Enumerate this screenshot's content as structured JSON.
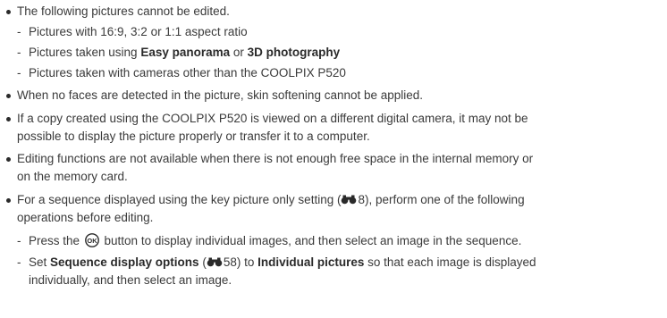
{
  "items": [
    {
      "text": "The following pictures cannot be edited.",
      "subitems": [
        {
          "text": "Pictures with 16:9, 3:2 or 1:1 aspect ratio"
        },
        {
          "pre": "Pictures taken using ",
          "bold1": "Easy panorama",
          "mid": " or ",
          "bold2": "3D photography"
        },
        {
          "text": "Pictures taken with cameras other than the COOLPIX P520"
        }
      ]
    },
    {
      "text": "When no faces are detected in the picture, skin softening cannot be applied."
    },
    {
      "line1": "If a copy created using the COOLPIX P520 is viewed on a different digital camera, it may not be",
      "line2": "possible to display the picture properly or transfer it to a computer."
    },
    {
      "line1": "Editing functions are not available when there is not enough free space in the internal memory or",
      "line2": "on the memory card."
    },
    {
      "pre": "For a sequence displayed using the key picture only setting (",
      "ref": "8",
      "post": "), perform one of the following",
      "line2": "operations before editing.",
      "subitems": [
        {
          "pre": "Press the ",
          "post": " button to display individual images, and then select an image in the sequence."
        },
        {
          "pre": "Set ",
          "bold1": "Sequence display options",
          "mid1": " (",
          "ref": "58",
          "mid2": ") to ",
          "bold2": "Individual pictures",
          "post": " so that each image is displayed",
          "line2": "individually, and then select an image."
        }
      ]
    }
  ],
  "icons": {
    "reference": "reference-binoculars-icon",
    "ok": "ok-button-icon"
  }
}
